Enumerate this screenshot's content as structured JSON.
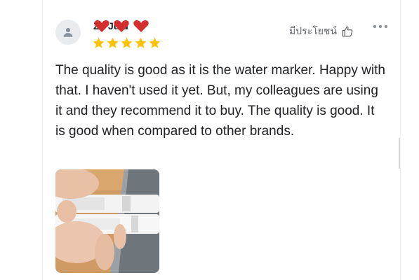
{
  "review": {
    "username": "Zu   Ju  u",
    "rating": 5,
    "helpful_label": "มีประโยชน์",
    "text": "The quality is good as it is the water marker. Happy with that. I haven't used it yet. But, my colleagues are using it and they recommend it to buy. The quality is good. It is good when compared to other brands."
  },
  "icons": {
    "avatar": "user-icon",
    "helpful": "thumbs-up-icon",
    "more": "more-horizontal-icon",
    "rating": "star-icon",
    "mask": "heart-icon"
  },
  "colors": {
    "star": "#FFC107",
    "mask_heart": "#D32F2F",
    "text": "#202124",
    "muted": "#5f6368"
  }
}
